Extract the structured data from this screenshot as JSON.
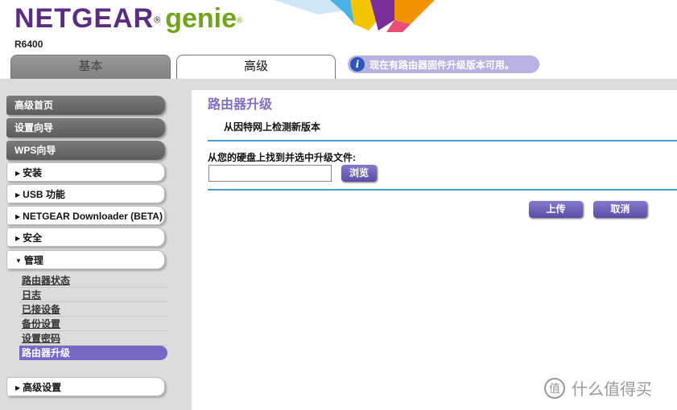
{
  "header": {
    "brand": "NETGEAR",
    "brand_mark": "®",
    "product": "genie",
    "product_mark": "®",
    "model": "R6400"
  },
  "tabs": [
    {
      "label": "基本",
      "active": false
    },
    {
      "label": "高级",
      "active": true
    }
  ],
  "notice": {
    "icon": "info-icon",
    "text": "现在有路由器固件升级版本可用。"
  },
  "sidebar": {
    "items": [
      {
        "label": "高级首页",
        "style": "dark"
      },
      {
        "label": "设置向导",
        "style": "dark"
      },
      {
        "label": "WPS向导",
        "style": "dark"
      },
      {
        "label": "安装",
        "style": "light",
        "expander": "▶"
      },
      {
        "label": "USB 功能",
        "style": "light",
        "expander": "▶"
      },
      {
        "label": "NETGEAR Downloader (BETA)",
        "style": "light",
        "expander": "▶"
      },
      {
        "label": "安全",
        "style": "light",
        "expander": "▶"
      },
      {
        "label": "管理",
        "style": "light",
        "expander": "▼"
      },
      {
        "label": "高级设置",
        "style": "light",
        "expander": "▶"
      }
    ],
    "admin_subitems": [
      "路由器状态",
      "日志",
      "已接设备",
      "备份设置",
      "设置密码",
      "路由器升级"
    ],
    "active_subitem": "路由器升级"
  },
  "main": {
    "title": "路由器升级",
    "check_online": "从因特网上检测新版本",
    "file_label": "从您的硬盘上找到并选中升级文件:",
    "file_value": "",
    "browse_label": "浏览",
    "upload_label": "上传",
    "cancel_label": "取消"
  },
  "colors": {
    "brand_purple": "#5a2d82",
    "genie_green": "#6fa51d",
    "accent_purple": "#7768c5",
    "rule_blue": "#4a9ccf"
  },
  "watermark": {
    "text": "什么值得买",
    "logo_char": "值"
  }
}
